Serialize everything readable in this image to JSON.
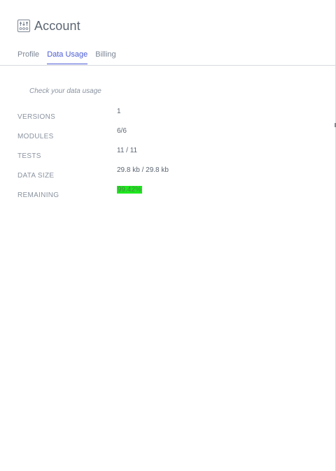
{
  "header": {
    "title": "Account",
    "icon": "sliders-icon"
  },
  "tabs": [
    {
      "label": "Profile",
      "active": false
    },
    {
      "label": "Data Usage",
      "active": true
    },
    {
      "label": "Billing",
      "active": false
    }
  ],
  "data_usage": {
    "subtitle": "Check your data usage",
    "rows": [
      {
        "label": "VERSIONS",
        "value": "1"
      },
      {
        "label": "MODULES",
        "value": "6/6"
      },
      {
        "label": "TESTS",
        "value": "11 / 11"
      },
      {
        "label": "DATA SIZE",
        "value": "29.8 kb / 29.8 kb"
      },
      {
        "label": "REMAINING",
        "value": "99.42%"
      }
    ]
  },
  "colors": {
    "accent": "#4a5bd4",
    "remaining_highlight": "#1de81d",
    "text": "#5c6672",
    "muted": "#8a93a0"
  }
}
